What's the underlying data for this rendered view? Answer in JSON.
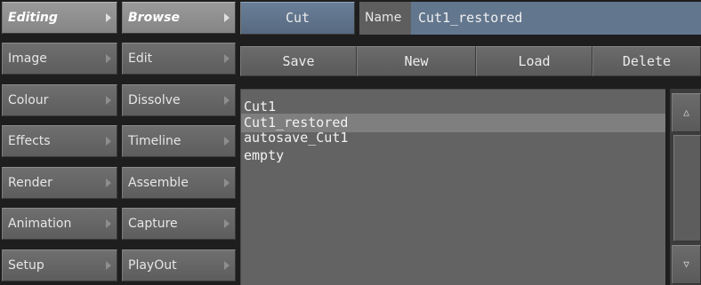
{
  "menu_left": {
    "items": [
      {
        "label": "Editing",
        "active": true
      },
      {
        "label": "Image"
      },
      {
        "label": "Colour"
      },
      {
        "label": "Effects"
      },
      {
        "label": "Render"
      },
      {
        "label": "Animation"
      },
      {
        "label": "Setup"
      }
    ]
  },
  "menu_right": {
    "items": [
      {
        "label": "Browse",
        "active": true
      },
      {
        "label": "Edit"
      },
      {
        "label": "Dissolve"
      },
      {
        "label": "Timeline"
      },
      {
        "label": "Assemble"
      },
      {
        "label": "Capture"
      },
      {
        "label": "PlayOut"
      }
    ]
  },
  "header": {
    "cut_label": "Cut",
    "name_label": "Name",
    "name_value": "Cut1_restored"
  },
  "toolbar": {
    "save_label": "Save",
    "new_label": "New",
    "load_label": "Load",
    "delete_label": "Delete"
  },
  "file_list": {
    "items": [
      "Cut1",
      "Cut1_restored",
      "autosave_Cut1",
      "empty"
    ],
    "selected_index": 1
  },
  "scrollbar": {
    "up_glyph": "△",
    "down_glyph": "▽"
  },
  "colors": {
    "cut_button": "#62768d",
    "name_field": "#62768d",
    "list_background": "#636363",
    "list_selected": "#7f7f7f",
    "active_menu": "#9a9a9a"
  }
}
